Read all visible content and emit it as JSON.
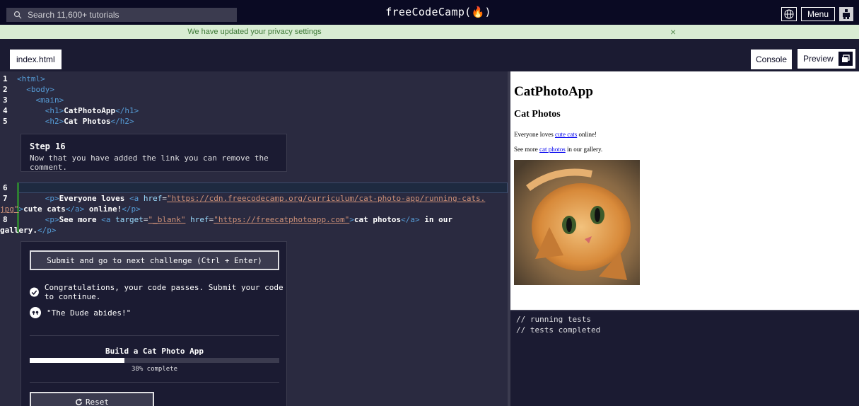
{
  "nav": {
    "search_placeholder": "Search 11,600+ tutorials",
    "brand": "freeCodeCamp(🔥)",
    "menu_label": "Menu"
  },
  "banner": {
    "message": "We have updated your privacy settings",
    "close": "×"
  },
  "tabs": {
    "file": "index.html",
    "console": "Console",
    "preview": "Preview"
  },
  "code": {
    "lines_top": [
      {
        "n": "1",
        "indent": "",
        "open": "<html>",
        "text": "",
        "close": ""
      },
      {
        "n": "2",
        "indent": "  ",
        "open": "<body>",
        "text": "",
        "close": ""
      },
      {
        "n": "3",
        "indent": "    ",
        "open": "<main>",
        "text": "",
        "close": ""
      },
      {
        "n": "4",
        "indent": "      ",
        "open": "<h1>",
        "text": "CatPhotoApp",
        "close": "</h1>"
      },
      {
        "n": "5",
        "indent": "      ",
        "open": "<h2>",
        "text": "Cat Photos",
        "close": "</h2>"
      }
    ],
    "line6_n": "6",
    "line7_n": "7",
    "line8_n": "8",
    "l7a": "      ",
    "l7_p_open": "<p>",
    "l7_text1": "Everyone loves ",
    "l7_a_open": "<a ",
    "l7_attr": "href",
    "l7_eq": "=",
    "l7_url1": "\"https://cdn.freecodecamp.org/curriculum/cat-photo-app/running-cats.",
    "l7_url2": "jpg\"",
    "l7_gt": ">",
    "l7_text2": "cute cats",
    "l7_a_close": "</a>",
    "l7_text3": " online!",
    "l7_p_close": "</p>",
    "l8_p_open": "<p>",
    "l8_text1": "See more ",
    "l8_a_open": "<a ",
    "l8_attr1": "target",
    "l8_val1": "\"_blank\"",
    "l8_attr2": "href",
    "l8_val2": "\"https://freecatphotoapp.com\"",
    "l8_gt": ">",
    "l8_text2": "cat photos",
    "l8_a_close": "</a>",
    "l8_text3": " in our",
    "l8_text4": "gallery.",
    "l8_p_close": "</p>"
  },
  "step": {
    "title": "Step 16",
    "description": "Now that you have added the link you can remove the comment."
  },
  "actions": {
    "submit_label": "Submit and go to next challenge (Ctrl + Enter)",
    "pass_message": "Congratulations, your code passes. Submit your code to continue.",
    "quote": "\"The Dude abides!\"",
    "project_title": "Build a Cat Photo App",
    "progress_percent": 38,
    "progress_label": "38% complete",
    "reset_label": "Reset"
  },
  "preview": {
    "h1": "CatPhotoApp",
    "h2": "Cat Photos",
    "p1_before": "Everyone loves ",
    "p1_link": "cute cats",
    "p1_after": " online!",
    "p2_before": "See more ",
    "p2_link": "cat photos",
    "p2_after": " in our gallery."
  },
  "console": {
    "lines": [
      "// running tests",
      "// tests completed"
    ]
  },
  "colors": {
    "background": "#0a0a23",
    "panel": "#1b1b32",
    "editor": "#2a2a40",
    "banner": "#d8ecd3",
    "banner_text": "#3d7a37"
  }
}
